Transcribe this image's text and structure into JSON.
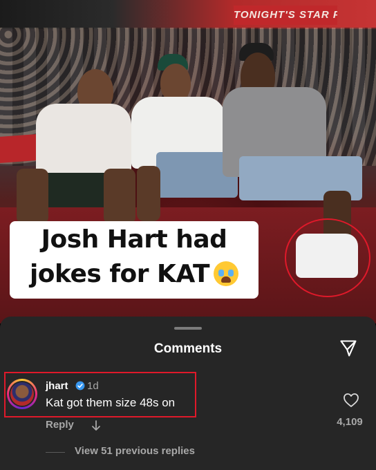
{
  "post": {
    "banner_text": "TONIGHT'S STAR PLAY HERE",
    "caption_line1": "Josh Hart had",
    "caption_line2": "jokes for KAT",
    "caption_emoji": "loudly-crying-face-icon",
    "highlight_color": "#e0192a"
  },
  "comments_sheet": {
    "title": "Comments",
    "share_icon": "send-icon",
    "comment": {
      "username": "jhart",
      "verified": true,
      "time": "1d",
      "text": "Kat got them size 48s on",
      "reply_label": "Reply",
      "like_count": "4,109",
      "like_icon": "heart-icon"
    },
    "view_replies": "View 51 previous replies"
  }
}
